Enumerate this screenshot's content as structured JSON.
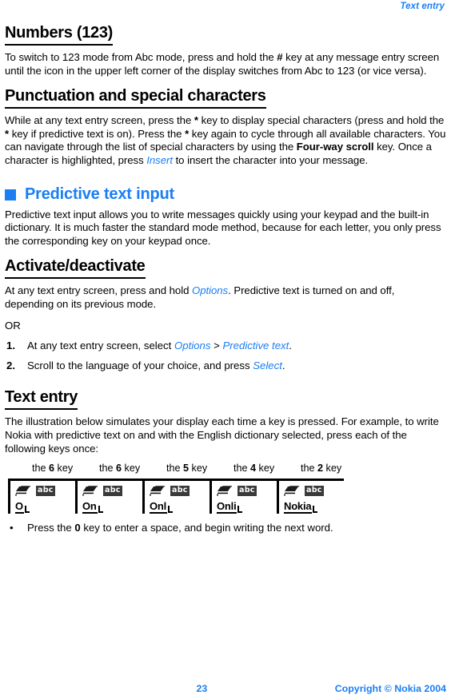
{
  "header": {
    "running_title": "Text entry"
  },
  "sections": {
    "numbers": {
      "heading": "Numbers (123)",
      "body_1": "To switch to 123 mode from Abc mode, press and hold the ",
      "body_bold_1": "#",
      "body_2": " key at any message entry screen until the icon in the upper left corner of the display switches from Abc to 123 (or vice versa)."
    },
    "punctuation": {
      "heading": "Punctuation and special characters",
      "p1": "While at any text entry screen, press the ",
      "star1": "*",
      "p2": " key to display special characters (press and hold the ",
      "star2": "*",
      "p3": " key if predictive text is on). Press the ",
      "star3": "*",
      "p4": " key again to cycle through all available characters. You can navigate through the list of special characters by using the ",
      "bold_four_way": "Four-way scroll",
      "p5": " key. Once a character is highlighted, press ",
      "link_insert": "Insert",
      "p6": " to insert the character into your message."
    },
    "predictive": {
      "heading": "Predictive text input",
      "bullet_color": "#1a7ef5",
      "body": "Predictive text input allows you to write messages quickly using your keypad and the built-in dictionary. It is much faster the standard mode method, because for each letter, you only press the corresponding key on your keypad once."
    },
    "activate": {
      "heading": "Activate/deactivate",
      "p1": "At any text entry screen, press and hold ",
      "link_options": "Options",
      "p2": ". Predictive text is turned on and off, depending on its previous mode.",
      "or": "OR",
      "steps": [
        {
          "num": "1.",
          "t1": "At any text entry screen, select ",
          "link1": "Options",
          "t2": " > ",
          "link2": "Predictive text",
          "t3": "."
        },
        {
          "num": "2.",
          "t1": "Scroll to the language of your choice, and press ",
          "link1": "Select",
          "t2": ".",
          "link2": "",
          "t3": ""
        }
      ]
    },
    "text_entry": {
      "heading": "Text entry",
      "body": "The illustration below simulates your display each time a key is pressed. For example, to write Nokia with predictive text on and with the English dictionary selected, press each of the following keys once:",
      "key_steps": [
        {
          "label_pre": "the ",
          "key": "6",
          "label_post": " key",
          "mode_badge": "abc",
          "display_text": "O"
        },
        {
          "label_pre": "the ",
          "key": "6",
          "label_post": " key",
          "mode_badge": "abc",
          "display_text": "On"
        },
        {
          "label_pre": "the ",
          "key": "5",
          "label_post": " key",
          "mode_badge": "abc",
          "display_text": "Onl"
        },
        {
          "label_pre": "the ",
          "key": "4",
          "label_post": " key",
          "mode_badge": "abc",
          "display_text": "Onli"
        },
        {
          "label_pre": "the ",
          "key": "2",
          "label_post": " key",
          "mode_badge": "abc",
          "display_text": "Nokia"
        }
      ],
      "bullet": {
        "dot": "•",
        "t1": "Press the ",
        "bold": "0",
        "t2": " key to enter a space, and begin writing the next word."
      }
    }
  },
  "footer": {
    "page_number": "23",
    "copyright": "Copyright © Nokia 2004",
    "color": "#1a7ef5"
  }
}
